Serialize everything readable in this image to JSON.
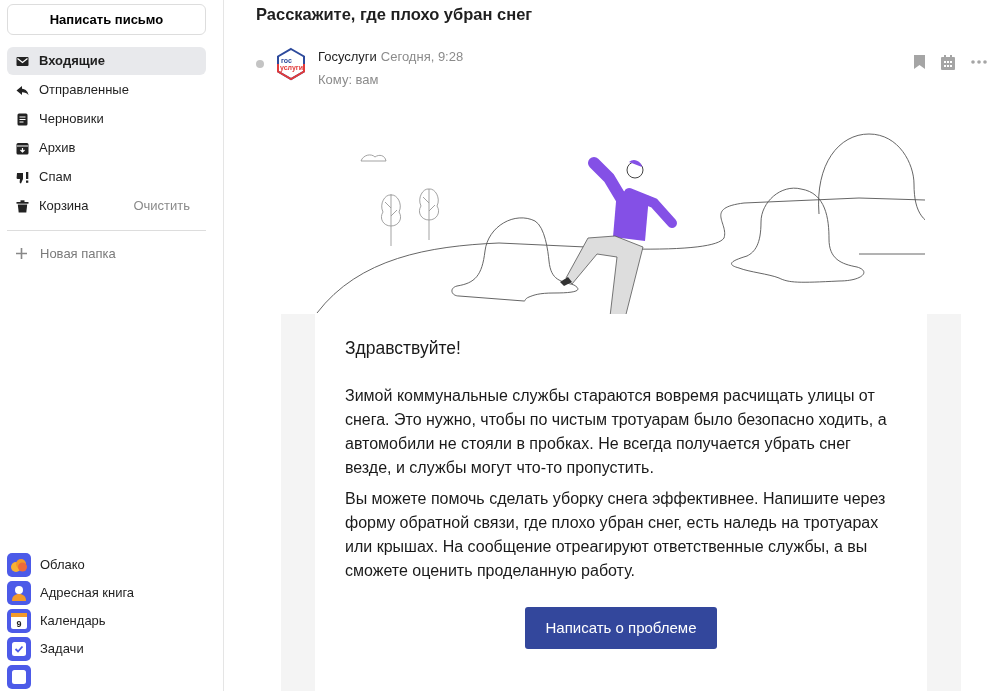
{
  "compose_button": "Написать письмо",
  "folders": [
    {
      "kind": "inbox",
      "label": "Входящие",
      "selected": true
    },
    {
      "kind": "sent",
      "label": "Отправленные",
      "selected": false
    },
    {
      "kind": "drafts",
      "label": "Черновики",
      "selected": false
    },
    {
      "kind": "archive",
      "label": "Архив",
      "selected": false
    },
    {
      "kind": "spam",
      "label": "Спам",
      "selected": false
    },
    {
      "kind": "trash",
      "label": "Корзина",
      "selected": false,
      "action": "Очистить"
    }
  ],
  "new_folder": "Новая папка",
  "apps": [
    {
      "kind": "cloud",
      "label": "Облако"
    },
    {
      "kind": "contacts",
      "label": "Адресная книга"
    },
    {
      "kind": "calendar",
      "label": "Календарь",
      "day": "9"
    },
    {
      "kind": "tasks",
      "label": "Задачи"
    },
    {
      "kind": "more"
    }
  ],
  "message": {
    "subject": "Расскажите, где плохо убран снег",
    "sender": "Госуслуги",
    "logo": "гос услуги",
    "date": "Сегодня, 9:28",
    "recipient": "Кому: вам",
    "greeting": "Здравствуйте!",
    "paragraphs": [
      "Зимой коммунальные службы стараются вовремя расчищать улицы от снега. Это нужно, чтобы по чистым тротуарам было безопасно ходить, а автомобили не стояли в пробках. Не всегда получается убрать снег везде, и службы могут что-то пропустить.",
      "Вы можете помочь сделать уборку снега эффективнее. Напишите через форму обратной связи, где плохо убран снег, есть наледь на тротуарах или крышах. На сообщение отреагируют ответственные службы, а вы сможете оценить проделанную работу."
    ],
    "button": "Написать о проблеме"
  }
}
